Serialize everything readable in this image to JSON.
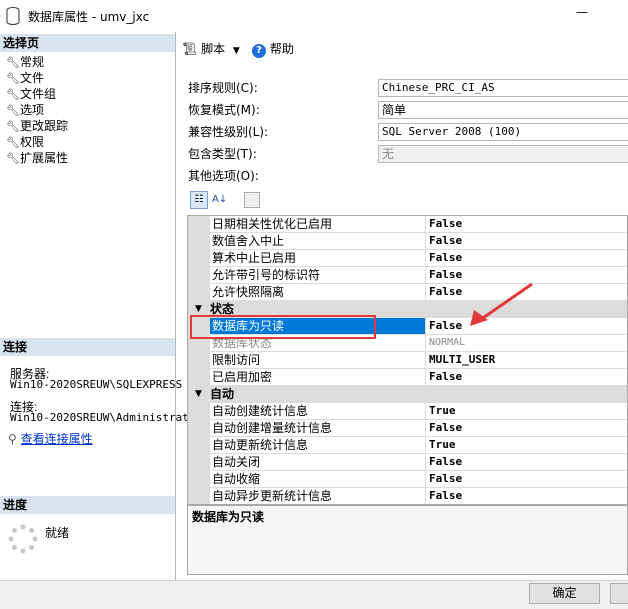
{
  "window": {
    "title": "数据库属性 - umv_jxc"
  },
  "left": {
    "select_page_header": "选择页",
    "pages": [
      "常规",
      "文件",
      "文件组",
      "选项",
      "更改跟踪",
      "权限",
      "扩展属性"
    ],
    "connection_header": "连接",
    "server_label": "服务器:",
    "server_value": "Win10-2020SREUW\\SQLEXPRESS",
    "connection_label": "连接:",
    "connection_value": "Win10-2020SREUW\\Administrat",
    "view_connection_link": "查看连接属性",
    "progress_header": "进度",
    "progress_status": "就绪"
  },
  "toolbar": {
    "script_label": "脚本",
    "help_label": "帮助"
  },
  "options": {
    "collation_label": "排序规则(C):",
    "collation_value": "Chinese_PRC_CI_AS",
    "recovery_label": "恢复模式(M):",
    "recovery_value": "简单",
    "compat_label": "兼容性级别(L):",
    "compat_value": "SQL Server 2008 (100)",
    "containment_label": "包含类型(T):",
    "containment_value": "无",
    "other_label": "其他选项(O):"
  },
  "grid": {
    "rows": [
      {
        "name": "日期相关性优化已启用",
        "value": "False"
      },
      {
        "name": "数值舍入中止",
        "value": "False"
      },
      {
        "name": "算术中止已启用",
        "value": "False"
      },
      {
        "name": "允许带引号的标识符",
        "value": "False"
      },
      {
        "name": "允许快照隔离",
        "value": "False"
      }
    ],
    "state_category": "状态",
    "state_rows": [
      {
        "name": "数据库为只读",
        "value": "False"
      },
      {
        "name": "数据库状态",
        "value": "NORMAL"
      },
      {
        "name": "限制访问",
        "value": "MULTI_USER"
      },
      {
        "name": "已启用加密",
        "value": "False"
      }
    ],
    "auto_category": "自动",
    "auto_rows": [
      {
        "name": "自动创建统计信息",
        "value": "True"
      },
      {
        "name": "自动创建增量统计信息",
        "value": "False"
      },
      {
        "name": "自动更新统计信息",
        "value": "True"
      },
      {
        "name": "自动关闭",
        "value": "False"
      },
      {
        "name": "自动收缩",
        "value": "False"
      },
      {
        "name": "自动异步更新统计信息",
        "value": "False"
      }
    ]
  },
  "description": "数据库为只读",
  "buttons": {
    "ok": "确定"
  },
  "colors": {
    "selection": "#0078d7",
    "annotation": "#e23a3a"
  }
}
